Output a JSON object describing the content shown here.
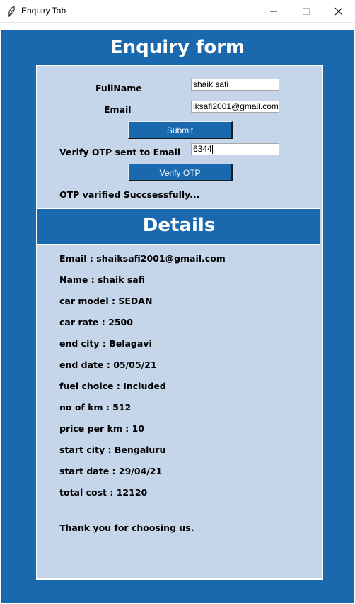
{
  "window": {
    "title": "Enquiry Tab",
    "icon": "feather-icon"
  },
  "form": {
    "heading": "Enquiry form",
    "fullname_label": "FullName",
    "fullname_value": "shaik safi",
    "email_label": "Email",
    "email_value": "iksafi2001@gmail.com",
    "submit_label": "Submit",
    "otp_label": "Verify OTP sent to Email",
    "otp_value": "6344",
    "verify_label": "Verify OTP",
    "status": "OTP varified Succsessfully..."
  },
  "details": {
    "heading": "Details",
    "lines": [
      "Email : shaiksafi2001@gmail.com",
      "Name : shaik safi",
      "car model : SEDAN",
      "car rate : 2500",
      "end city : Belagavi",
      "end date : 05/05/21",
      "fuel choice : Included",
      "no of km : 512",
      "price per km : 10",
      "start city : Bengaluru",
      "start date : 29/04/21",
      "total cost : 12120"
    ],
    "thanks": "Thank you for choosing us."
  },
  "colors": {
    "accent": "#1a68ae",
    "panel": "#c5d5ea"
  }
}
